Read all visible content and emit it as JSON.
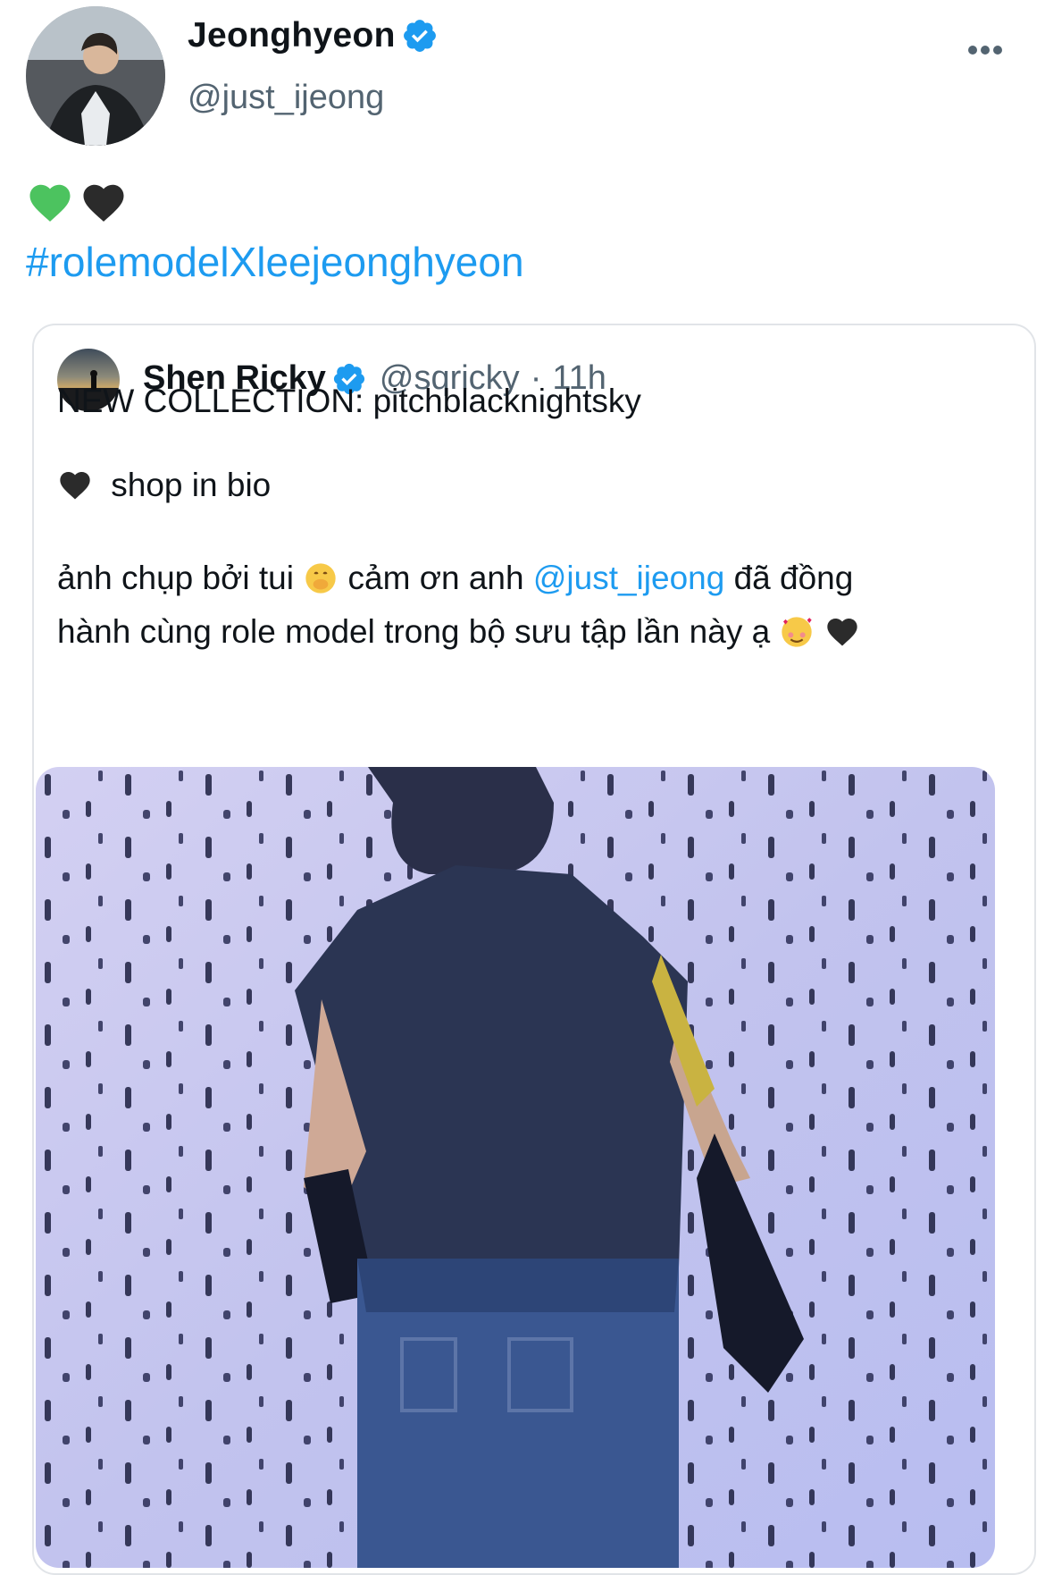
{
  "author": {
    "display_name": "Jeonghyeon",
    "handle": "@just_ijeong"
  },
  "tweet": {
    "hashtag": "#rolemodelXleejeonghyeon"
  },
  "quoted": {
    "display_name": "Shen Ricky",
    "handle": "@sqricky",
    "separator": "·",
    "time": "11h",
    "line1": "NEW COLLECTION: pitchblacknightsky",
    "line2": "shop in bio",
    "line3_a": "ảnh chụp bởi tui",
    "line3_b": "cảm ơn anh",
    "line3_mention": "@just_ijeong",
    "line3_c": "đã đồng",
    "line4": "hành cùng role model trong bộ sưu tập lần này ạ"
  },
  "colors": {
    "link": "#1d9bf0",
    "muted": "#536471",
    "verified": "#1d9bf0",
    "green_heart": "#4cc35f",
    "black_heart": "#2b2b2b"
  },
  "icons": [
    "verified-badge-icon",
    "more-options-icon",
    "green-heart-emoji",
    "black-heart-emoji",
    "hand-over-mouth-emoji",
    "smiling-face-with-hearts-emoji"
  ]
}
